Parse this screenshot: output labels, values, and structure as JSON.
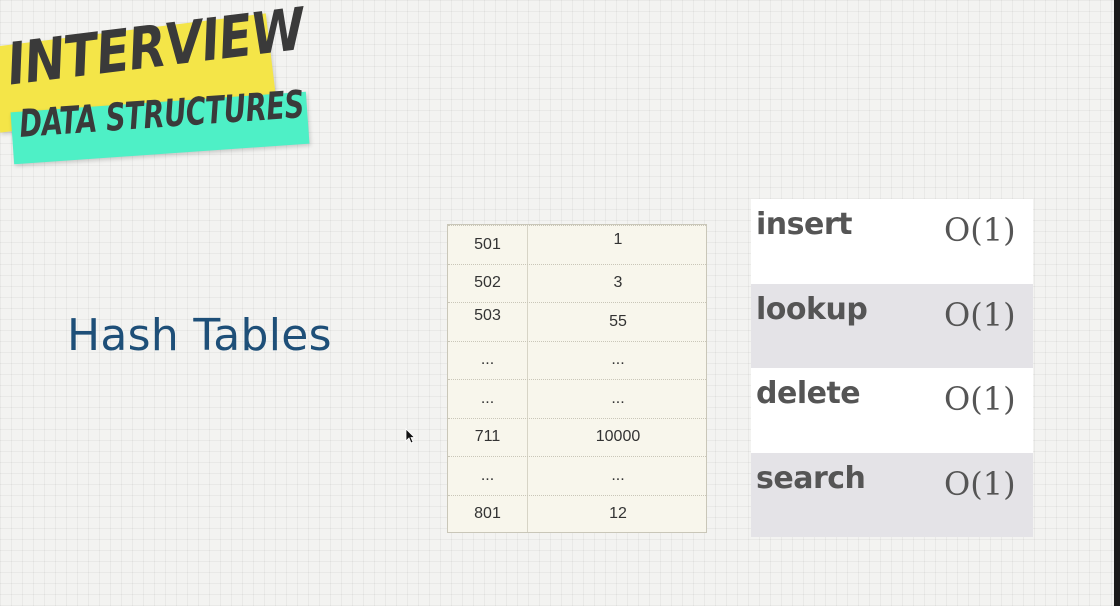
{
  "logo": {
    "line1": "INTERVIEW",
    "line2": "DATA STRUCTURES"
  },
  "title": "Hash Tables",
  "hash_table": {
    "rows": [
      {
        "key": "501",
        "value": "1"
      },
      {
        "key": "502",
        "value": "3"
      },
      {
        "key": "503",
        "value": "55"
      },
      {
        "key": "...",
        "value": "..."
      },
      {
        "key": "...",
        "value": "..."
      },
      {
        "key": "711",
        "value": "10000"
      },
      {
        "key": "...",
        "value": "..."
      },
      {
        "key": "801",
        "value": "12"
      }
    ]
  },
  "operations": [
    {
      "name": "insert",
      "complexity": "O(1)"
    },
    {
      "name": "lookup",
      "complexity": "O(1)"
    },
    {
      "name": "delete",
      "complexity": "O(1)"
    },
    {
      "name": "search",
      "complexity": "O(1)"
    }
  ],
  "colors": {
    "logo_yellow": "#f4e548",
    "logo_teal": "#4ef0c6",
    "title_blue": "#1e4f78",
    "row_gray": "#e4e3e7",
    "table_bg": "#f8f6ec"
  }
}
